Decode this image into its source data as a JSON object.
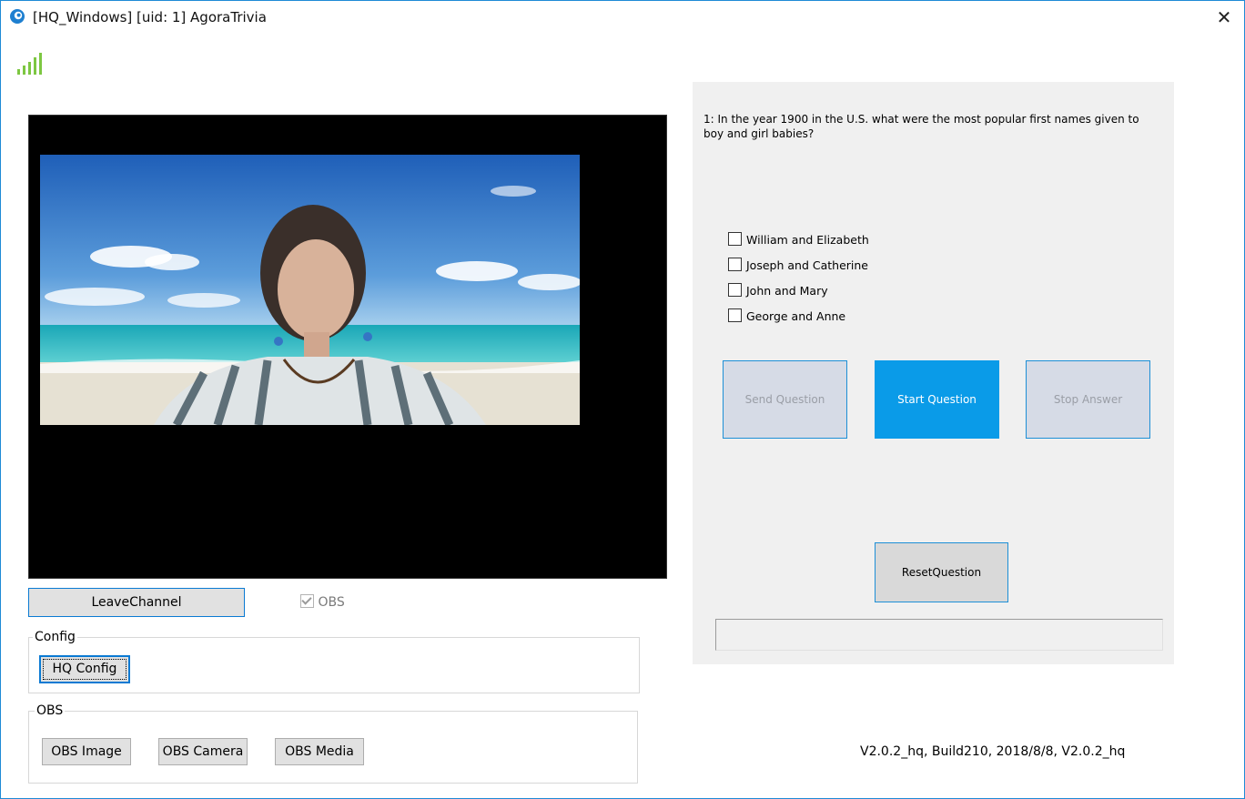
{
  "window": {
    "title": "[HQ_Windows] [uid: 1] AgoraTrivia",
    "close": "✕"
  },
  "signal": {
    "icon": "signal-strength-icon",
    "color": "#7dc742",
    "bars": 5
  },
  "controls": {
    "leave_label": "LeaveChannel",
    "obs_checkbox_label": "OBS",
    "obs_checked": true
  },
  "config": {
    "group_label": "Config",
    "hq_config_label": "HQ Config"
  },
  "obs": {
    "group_label": "OBS",
    "buttons": [
      "OBS Image",
      "OBS Camera",
      "OBS Media"
    ]
  },
  "question_panel": {
    "question": "1: In the year 1900 in the U.S. what were the most popular first names given to boy and girl babies?",
    "options": [
      "William and Elizabeth",
      "Joseph and Catherine",
      "John and Mary",
      "George and Anne"
    ],
    "send_label": "Send Question",
    "start_label": "Start Question",
    "stop_label": "Stop Answer",
    "reset_label": "ResetQuestion",
    "answer_value": ""
  },
  "version": "V2.0.2_hq, Build210, 2018/8/8, V2.0.2_hq",
  "colors": {
    "accent": "#0a9be8",
    "border_accent": "#1d8fd6",
    "panel_bg": "#f0f0f0"
  }
}
